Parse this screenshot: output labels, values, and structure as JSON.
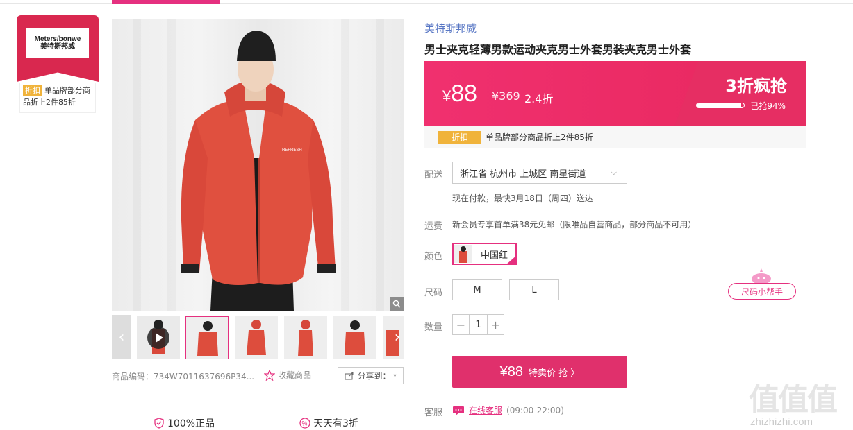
{
  "brand_card": {
    "logo_line1": "Meters/bonwe",
    "logo_line2": "美特斯邦威",
    "promo_tag": "折扣",
    "promo_text": "单品牌部分商品折上2件85折"
  },
  "gallery": {
    "sku_code": "商品编码：734W7011637696P34...",
    "favorite_label": "收藏商品",
    "share_label": "分享到："
  },
  "guarantees": [
    "100%正品",
    "天天有3折"
  ],
  "product": {
    "brand": "美特斯邦威",
    "title": "男士夹克轻薄男款运动夹克男士外套男装夹克男士外套"
  },
  "price": {
    "current": "88",
    "currency": "¥",
    "original": "¥369",
    "discount": "2.4折",
    "flash_title": "3折疯抢",
    "sold_text": "已抢94%",
    "sold_fraction": 0.94
  },
  "promo": {
    "tag": "折扣",
    "text": "单品牌部分商品折上2件85折"
  },
  "delivery": {
    "label": "配送",
    "address": "浙江省 杭州市 上城区 南星街道",
    "note": "现在付款，最快3月18日（周四）送达"
  },
  "shipping": {
    "label": "运费",
    "text": "新会员专享首单满38元免邮（限唯品自营商品，部分商品不可用）"
  },
  "color": {
    "label": "颜色",
    "selected": "中国红"
  },
  "size": {
    "label": "尺码",
    "options": [
      "M",
      "L"
    ],
    "helper": "尺码小帮手"
  },
  "quantity": {
    "label": "数量",
    "value": "1"
  },
  "buy_button": {
    "price": "¥88",
    "label": "特卖价 抢 〉"
  },
  "service": {
    "label": "客服",
    "link": "在线客服",
    "hours": "(09:00-22:00)"
  },
  "watermark": {
    "chars": "值值值",
    "url": "zhizhizhi.com"
  },
  "colors": {
    "accent": "#e5307f",
    "banner": "#f0306f",
    "brand_link": "#5776c4",
    "tag_yellow": "#f0b33b"
  }
}
